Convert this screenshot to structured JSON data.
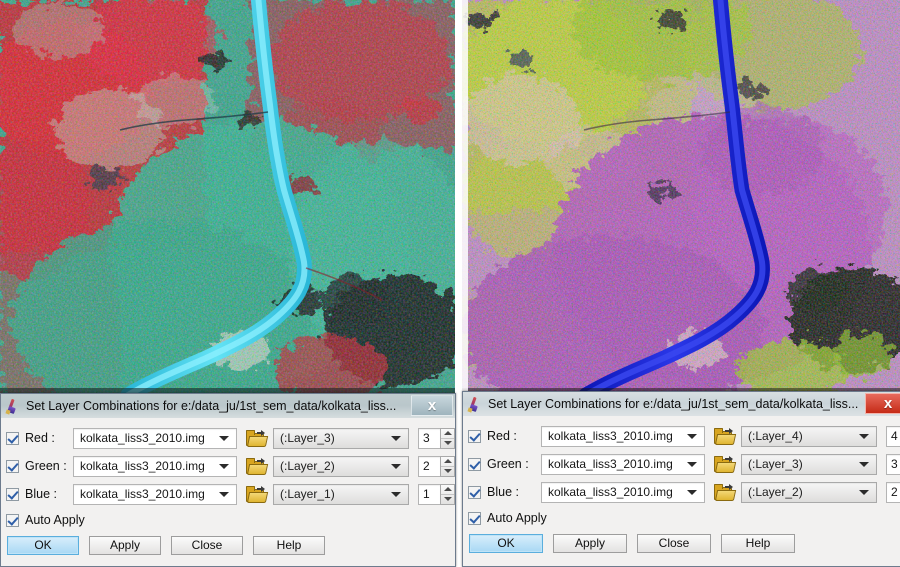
{
  "app": {
    "icon": "paintbrush-icon",
    "window_count": 2
  },
  "panels": [
    {
      "name": "left-image-panel",
      "description": "False-colour satellite composite of Kolkata, LISS-3 2010 — bands 3,2,1 (R,G,B). Cyan Hooghly river, red vegetation, teal-green urban fabric.",
      "river_color": "#4fd6ec",
      "vegetation_color": "#d4172a",
      "urban_color": "#3fae92",
      "background_color": "#2e9f86"
    },
    {
      "name": "right-image-panel",
      "description": "False-colour satellite composite of Kolkata, LISS-3 2010 — bands 4,3,2 (R,G,B). Deep blue Hooghly river, magenta urban, yellow-green vegetation.",
      "river_color": "#1a27d8",
      "vegetation_color": "#b8d426",
      "urban_color": "#b44fc0",
      "background_color": "#c07ec8"
    }
  ],
  "dialog_left": {
    "title": "Set Layer Combinations for e:/data_ju/1st_sem_data/kolkata_liss...",
    "close_label": "x",
    "close_style": "#a9bcc4",
    "channels": [
      {
        "label": "Red :",
        "checked": true,
        "file": "kolkata_liss3_2010.img",
        "layer": "(:Layer_3)",
        "index": "3"
      },
      {
        "label": "Green :",
        "checked": true,
        "file": "kolkata_liss3_2010.img",
        "layer": "(:Layer_2)",
        "index": "2"
      },
      {
        "label": "Blue :",
        "checked": true,
        "file": "kolkata_liss3_2010.img",
        "layer": "(:Layer_1)",
        "index": "1"
      }
    ],
    "auto_apply": {
      "label": "Auto Apply",
      "checked": true
    },
    "buttons": [
      {
        "label": "OK",
        "default": true
      },
      {
        "label": "Apply",
        "default": false
      },
      {
        "label": "Close",
        "default": false
      },
      {
        "label": "Help",
        "default": false
      }
    ]
  },
  "dialog_right": {
    "title": "Set Layer Combinations for e:/data_ju/1st_sem_data/kolkata_liss...",
    "close_label": "x",
    "close_style": "#cc2e19",
    "channels": [
      {
        "label": "Red :",
        "checked": true,
        "file": "kolkata_liss3_2010.img",
        "layer": "(:Layer_4)",
        "index": "4"
      },
      {
        "label": "Green :",
        "checked": true,
        "file": "kolkata_liss3_2010.img",
        "layer": "(:Layer_3)",
        "index": "3"
      },
      {
        "label": "Blue :",
        "checked": true,
        "file": "kolkata_liss3_2010.img",
        "layer": "(:Layer_2)",
        "index": "2"
      }
    ],
    "auto_apply": {
      "label": "Auto Apply",
      "checked": true
    },
    "buttons": [
      {
        "label": "OK",
        "default": true
      },
      {
        "label": "Apply",
        "default": false
      },
      {
        "label": "Close",
        "default": false
      },
      {
        "label": "Help",
        "default": false
      }
    ]
  }
}
